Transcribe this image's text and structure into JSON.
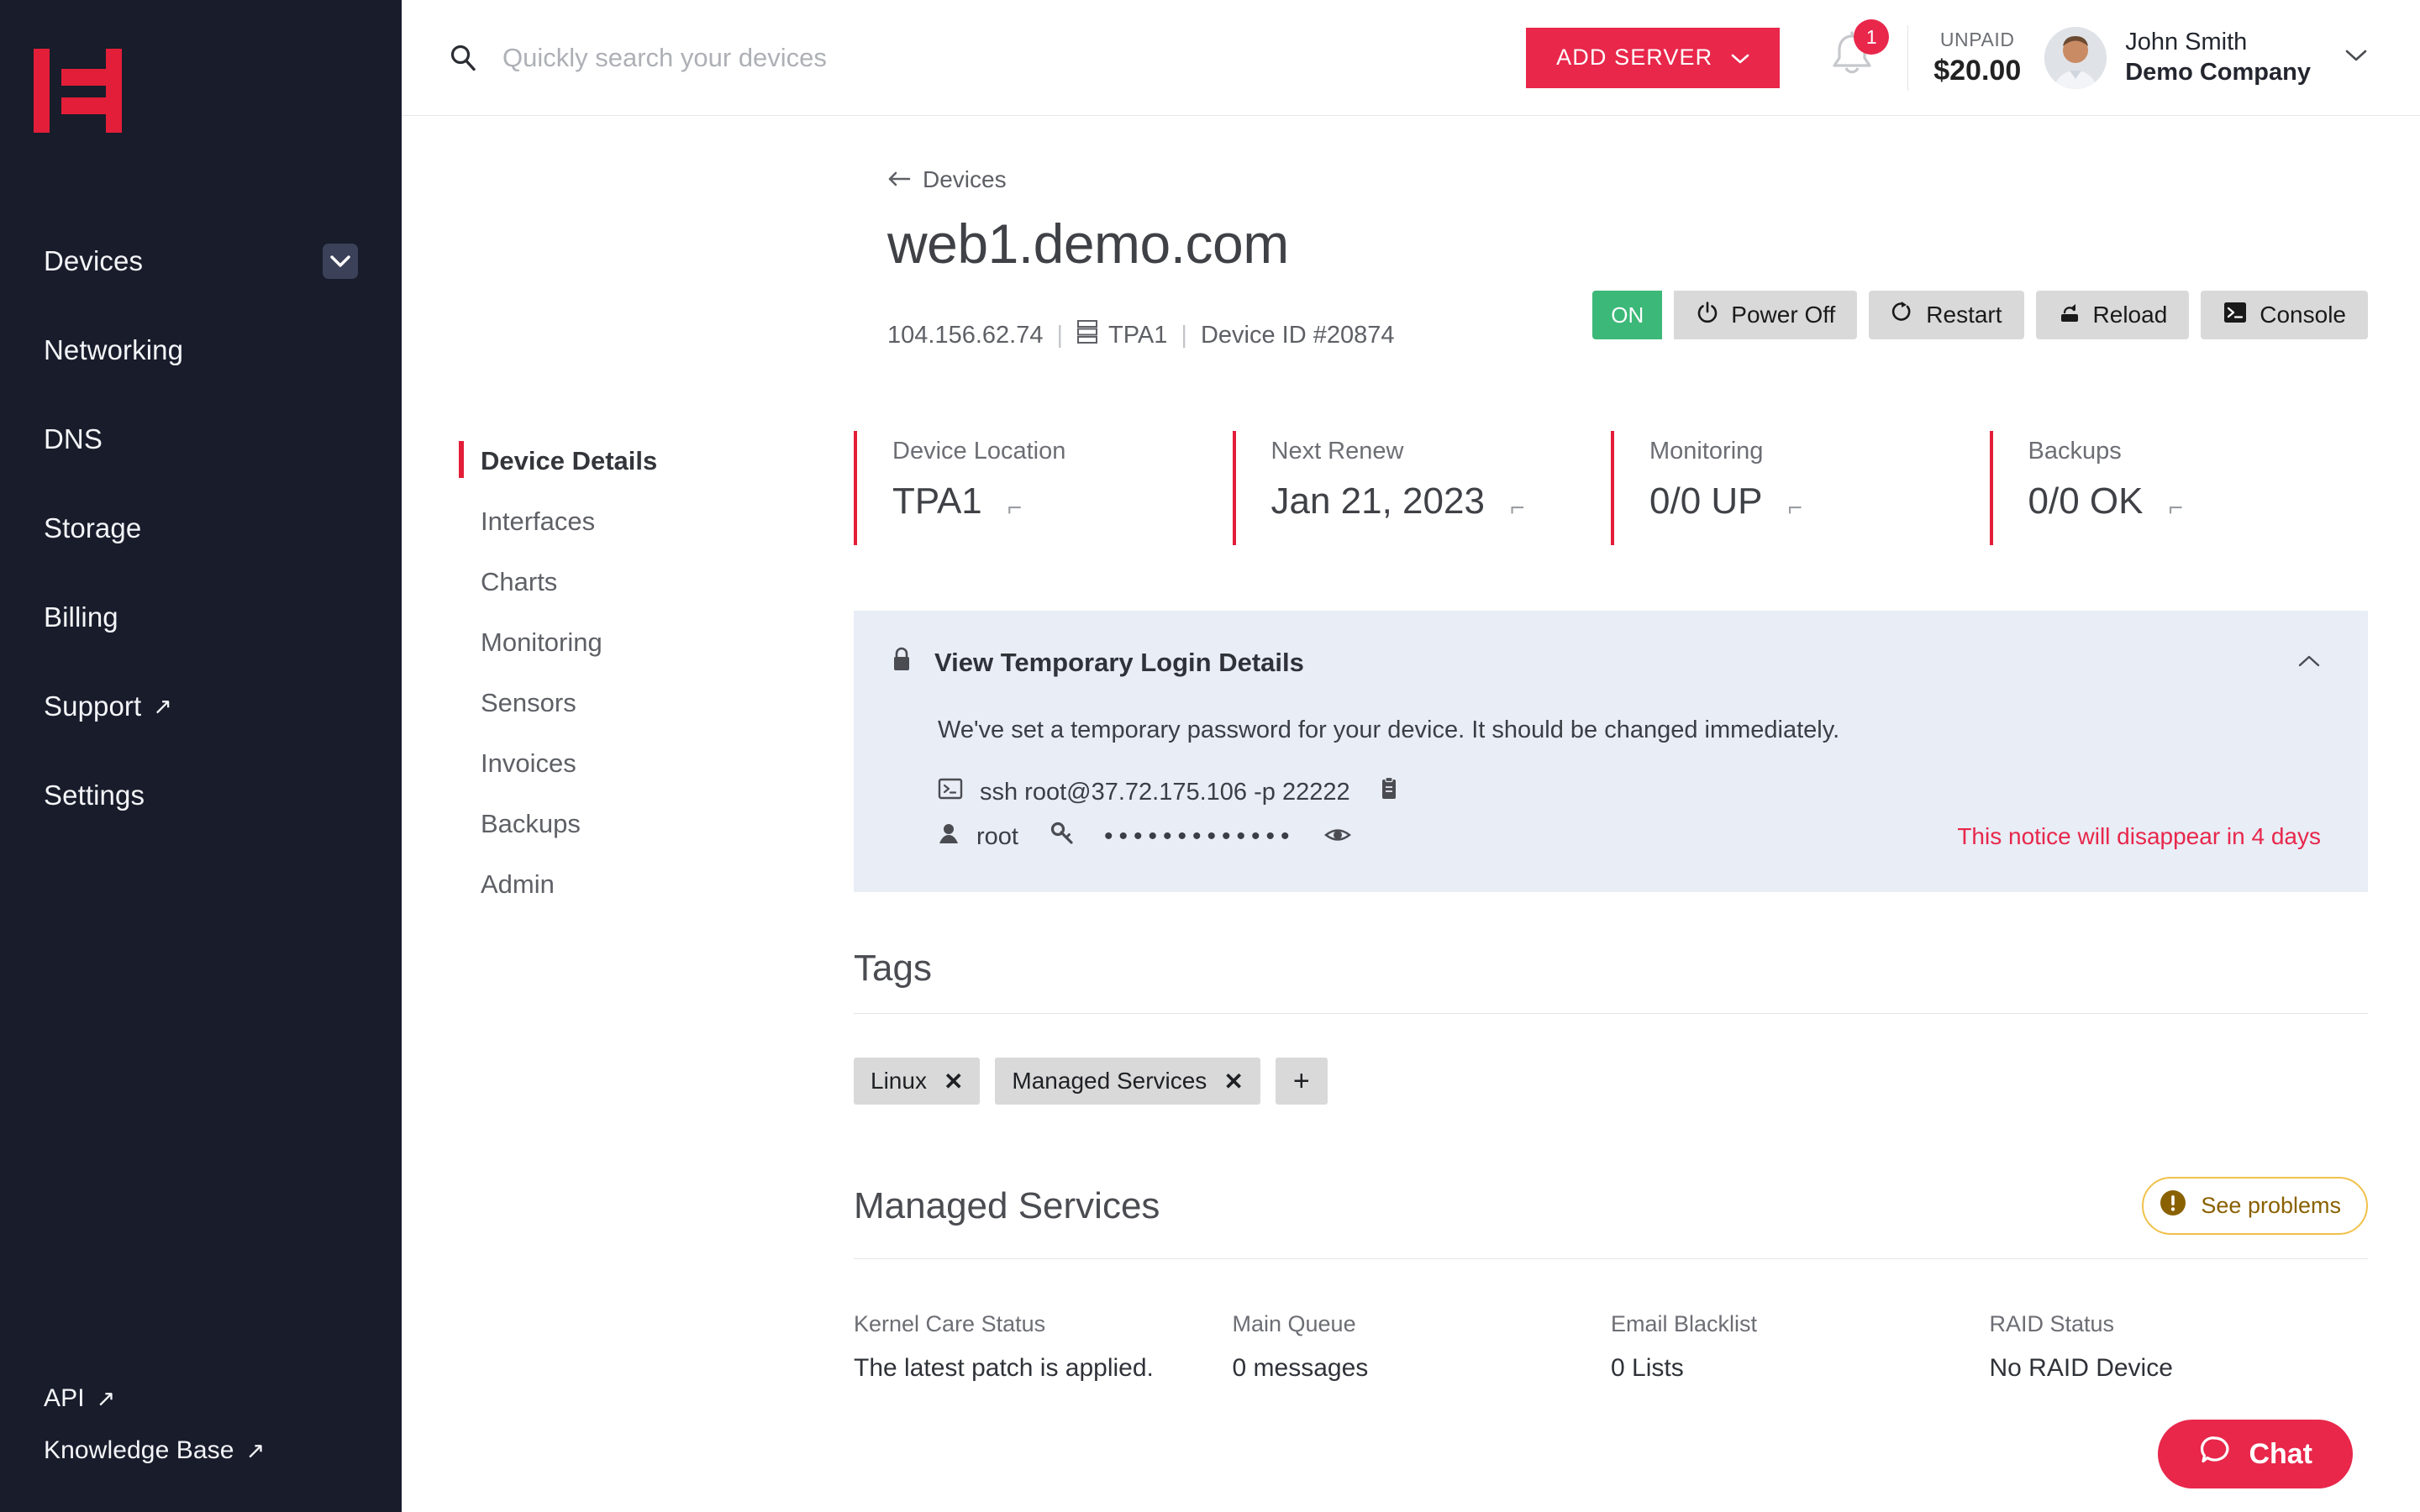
{
  "sidebar": {
    "logo_name": "hivelocity-logo",
    "items": [
      {
        "label": "Devices",
        "has_chevron": true,
        "external": false
      },
      {
        "label": "Networking",
        "has_chevron": false,
        "external": false
      },
      {
        "label": "DNS",
        "has_chevron": false,
        "external": false
      },
      {
        "label": "Storage",
        "has_chevron": false,
        "external": false
      },
      {
        "label": "Billing",
        "has_chevron": false,
        "external": false
      },
      {
        "label": "Support",
        "has_chevron": false,
        "external": true
      },
      {
        "label": "Settings",
        "has_chevron": false,
        "external": false
      }
    ],
    "bottom_items": [
      {
        "label": "API",
        "external": true
      },
      {
        "label": "Knowledge Base",
        "external": true
      }
    ]
  },
  "topbar": {
    "search_placeholder": "Quickly search your devices",
    "search_value": "",
    "add_server_label": "ADD SERVER",
    "notification_count": "1",
    "unpaid_label": "UNPAID",
    "unpaid_amount": "$20.00",
    "user_name": "John Smith",
    "user_company": "Demo Company"
  },
  "page": {
    "back_label": "Devices",
    "title": "web1.demo.com",
    "ip": "104.156.62.74",
    "location": "TPA1",
    "device_id": "Device ID #20874",
    "separator": "|"
  },
  "actions": {
    "power_state": "ON",
    "power_off": "Power Off",
    "restart": "Restart",
    "reload": "Reload",
    "console": "Console"
  },
  "tabs": [
    {
      "label": "Device Details",
      "active": true
    },
    {
      "label": "Interfaces",
      "active": false
    },
    {
      "label": "Charts",
      "active": false
    },
    {
      "label": "Monitoring",
      "active": false
    },
    {
      "label": "Sensors",
      "active": false
    },
    {
      "label": "Invoices",
      "active": false
    },
    {
      "label": "Backups",
      "active": false
    },
    {
      "label": "Admin",
      "active": false
    }
  ],
  "stats": [
    {
      "label": "Device Location",
      "value": "TPA1"
    },
    {
      "label": "Next Renew",
      "value": "Jan 21, 2023"
    },
    {
      "label": "Monitoring",
      "value": "0/0 UP"
    },
    {
      "label": "Backups",
      "value": "0/0 OK"
    }
  ],
  "notice": {
    "title": "View Temporary Login Details",
    "description": "We've set a temporary password for your device. It should be changed immediately.",
    "ssh_command": "ssh root@37.72.175.106 -p 22222",
    "username": "root",
    "password_masked": "•••••••••••••",
    "expiry_text": "This notice will disappear in 4 days"
  },
  "tags_section": {
    "title": "Tags",
    "tags": [
      "Linux",
      "Managed Services"
    ],
    "remove_glyph": "✕",
    "add_glyph": "+"
  },
  "managed_services": {
    "title": "Managed Services",
    "see_problems_label": "See problems",
    "cells": [
      {
        "label": "Kernel Care Status",
        "value": "The latest patch is applied."
      },
      {
        "label": "Main Queue",
        "value": "0 messages"
      },
      {
        "label": "Email Blacklist",
        "value": "0 Lists"
      },
      {
        "label": "RAID Status",
        "value": "No RAID Device"
      }
    ]
  },
  "chat": {
    "label": "Chat"
  },
  "colors": {
    "accent_red": "#E31E38",
    "brand_red": "#E8274B",
    "sidebar_bg": "#181C2B",
    "status_green": "#3CB878",
    "notice_bg": "#E8EDF6",
    "warn_yellow": "#F0C14B"
  }
}
